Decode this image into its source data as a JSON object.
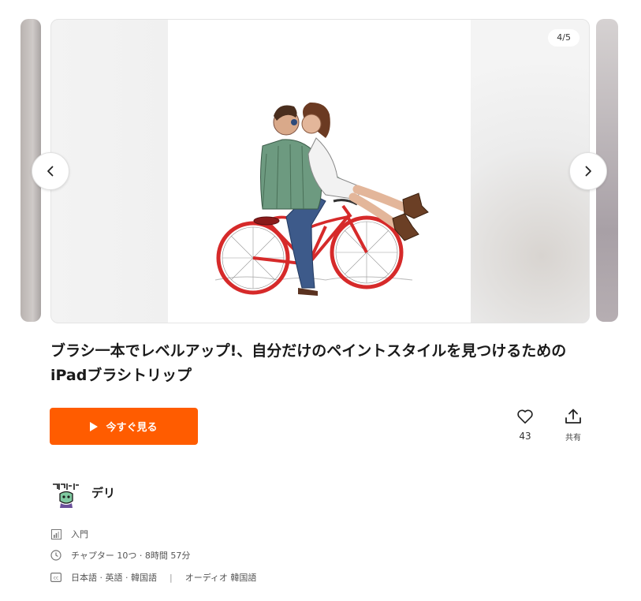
{
  "carousel": {
    "counter": "4/5",
    "prev_icon": "chevron-left-icon",
    "next_icon": "chevron-right-icon"
  },
  "course": {
    "title": "ブラシ一本でレベルアップ!、自分だけのペイントスタイルを見つけるためのiPadブラシトリップ",
    "watch_label": "今すぐ見る",
    "likes": "43",
    "share_label": "共有"
  },
  "creator": {
    "name": "デリ"
  },
  "meta": {
    "level": "入門",
    "chapters": "チャプター 10つ · 8時間 57分",
    "subtitles": "日本語 · 英語 · 韓国語",
    "separator": "|",
    "audio": "オーディオ 韓国語"
  },
  "colors": {
    "accent": "#ff5c00",
    "bicycle": "#d62a2a"
  }
}
